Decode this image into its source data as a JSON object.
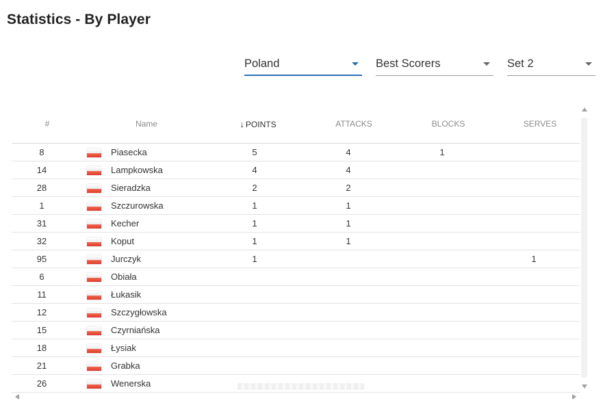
{
  "page": {
    "title": "Statistics - By Player"
  },
  "filters": {
    "team": {
      "value": "Poland"
    },
    "category": {
      "value": "Best Scorers"
    },
    "set": {
      "value": "Set 2"
    }
  },
  "table": {
    "columns": {
      "num": "#",
      "name": "Name",
      "points": "POINTS",
      "attacks": "ATTACKS",
      "blocks": "BLOCKS",
      "serves": "SERVES"
    },
    "sort_icon": "arrow-down-icon",
    "rows": [
      {
        "num": "8",
        "flag": "poland-flag-icon",
        "name": "Piasecka",
        "points": "5",
        "attacks": "4",
        "blocks": "1",
        "serves": ""
      },
      {
        "num": "14",
        "flag": "poland-flag-icon",
        "name": "Lampkowska",
        "points": "4",
        "attacks": "4",
        "blocks": "",
        "serves": ""
      },
      {
        "num": "28",
        "flag": "poland-flag-icon",
        "name": "Sieradzka",
        "points": "2",
        "attacks": "2",
        "blocks": "",
        "serves": ""
      },
      {
        "num": "1",
        "flag": "poland-flag-icon",
        "name": "Szczurowska",
        "points": "1",
        "attacks": "1",
        "blocks": "",
        "serves": ""
      },
      {
        "num": "31",
        "flag": "poland-flag-icon",
        "name": "Kecher",
        "points": "1",
        "attacks": "1",
        "blocks": "",
        "serves": ""
      },
      {
        "num": "32",
        "flag": "poland-flag-icon",
        "name": "Koput",
        "points": "1",
        "attacks": "1",
        "blocks": "",
        "serves": ""
      },
      {
        "num": "95",
        "flag": "poland-flag-icon",
        "name": "Jurczyk",
        "points": "1",
        "attacks": "",
        "blocks": "",
        "serves": "1"
      },
      {
        "num": "6",
        "flag": "poland-flag-icon",
        "name": "Obiała",
        "points": "",
        "attacks": "",
        "blocks": "",
        "serves": ""
      },
      {
        "num": "11",
        "flag": "poland-flag-icon",
        "name": "Łukasik",
        "points": "",
        "attacks": "",
        "blocks": "",
        "serves": ""
      },
      {
        "num": "12",
        "flag": "poland-flag-icon",
        "name": "Szczygłowska",
        "points": "",
        "attacks": "",
        "blocks": "",
        "serves": ""
      },
      {
        "num": "15",
        "flag": "poland-flag-icon",
        "name": "Czyrniańska",
        "points": "",
        "attacks": "",
        "blocks": "",
        "serves": ""
      },
      {
        "num": "18",
        "flag": "poland-flag-icon",
        "name": "Łysiak",
        "points": "",
        "attacks": "",
        "blocks": "",
        "serves": ""
      },
      {
        "num": "21",
        "flag": "poland-flag-icon",
        "name": "Grabka",
        "points": "",
        "attacks": "",
        "blocks": "",
        "serves": ""
      },
      {
        "num": "26",
        "flag": "poland-flag-icon",
        "name": "Wenerska",
        "points": "",
        "attacks": "",
        "blocks": "",
        "serves": ""
      }
    ]
  },
  "colors": {
    "accent": "#2a6fb3",
    "flag_red": "#dc143c",
    "flag_white": "#ffffff"
  }
}
